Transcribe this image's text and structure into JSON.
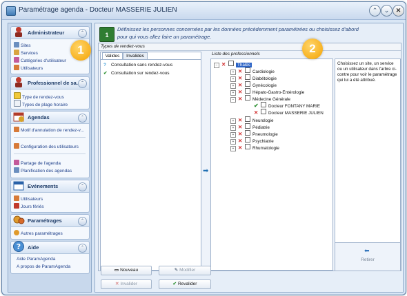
{
  "window": {
    "title": "Paramétrage agenda - Docteur MASSERIE JULIEN",
    "buttons": [
      "⌃",
      "⌄",
      "✕"
    ]
  },
  "sidebar": {
    "sections": [
      {
        "title": "Administrateur",
        "items": [
          "Sites",
          "Services",
          "Catégories d'utilisateur",
          "Utilisateurs"
        ]
      },
      {
        "title": "Professionnel de sa...",
        "items": [
          "Type de rendez-vous",
          "Types de plage horaire"
        ]
      },
      {
        "title": "Agendas",
        "items": [
          "Motif d'annulation de rendez-v...",
          "Configuration des utilisateurs",
          "Partage de l'agenda",
          "Planification des agendas"
        ]
      },
      {
        "title": "Evénements",
        "items": [
          "Utilisateurs",
          "Jours fériés"
        ]
      },
      {
        "title": "Paramétrages",
        "items": [
          "Autres paramétrages"
        ]
      },
      {
        "title": "Aide",
        "items": [
          "Aide ParamAgenda",
          "A propos de ParamAgenda"
        ]
      }
    ]
  },
  "main": {
    "instructions": "Définissez les personnes concernées par les données précédemment paramétrées ou choisissez d'abord pour qui vous allez faire un paramétrage.",
    "section_title": "Types de rendez-vous",
    "tabs": [
      "Valides",
      "Invalides"
    ],
    "types": [
      {
        "label": "Consultation sans rendez-vous",
        "icon": "question-icon"
      },
      {
        "label": "Consultation sur rendez-vous",
        "icon": "check-icon"
      }
    ],
    "pros_label": "Liste des professionnels",
    "tree": {
      "root": "Thalès",
      "children": [
        "Cardiologie",
        "Diabétologie",
        "Gynécologie",
        "Hépato-Gastro-Entérologie",
        "Médecine Générale"
      ],
      "doctors": [
        "Docteur FONTANY MARIE",
        "Docteur MASSERIE JULIEN"
      ],
      "after": [
        "Neurologie",
        "Pédiatrie",
        "Pneumologie",
        "Psychiatrie",
        "Rhumatologie"
      ]
    },
    "help_text": "Choisissez un site, un service ou un utilisateur dans l'arbre ci-contre pour voir le paramétrage qui lui a été attribué.",
    "retirer_label": "Retirer",
    "buttons": {
      "nouveau": "Nouveau",
      "modifier": "Modifier",
      "invalider": "Invalider",
      "revalider": "Revalider"
    }
  },
  "badges": [
    "1",
    "2"
  ],
  "colors": {
    "accent": "#2b63c6",
    "badge": "#f4a200",
    "error_x": "#d12b2b",
    "ok": "#2a8f2f"
  }
}
